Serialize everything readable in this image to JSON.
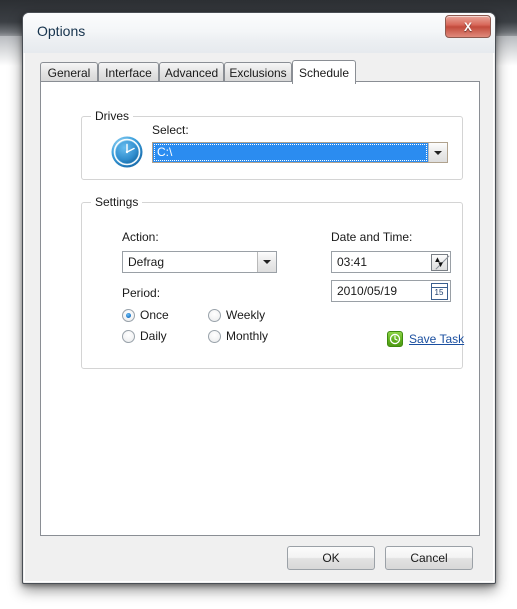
{
  "window": {
    "title": "Options",
    "close_label": "X"
  },
  "tabs": [
    {
      "label": "General",
      "active": false
    },
    {
      "label": "Interface",
      "active": false
    },
    {
      "label": "Advanced",
      "active": false
    },
    {
      "label": "Exclusions",
      "active": false
    },
    {
      "label": "Schedule",
      "active": true
    }
  ],
  "drives": {
    "legend": "Drives",
    "select_label": "Select:",
    "selected_drive": "C:\\",
    "icon": "clock-disk-icon"
  },
  "settings": {
    "legend": "Settings",
    "action_label": "Action:",
    "action_value": "Defrag",
    "period_label": "Period:",
    "period_options": [
      {
        "label": "Once",
        "checked": true
      },
      {
        "label": "Weekly",
        "checked": false
      },
      {
        "label": "Daily",
        "checked": false
      },
      {
        "label": "Monthly",
        "checked": false
      }
    ],
    "datetime_label": "Date and Time:",
    "time_value": "03:41",
    "date_value": "2010/05/19",
    "calendar_day": "15",
    "spin_up": "▲",
    "spin_down": "▼",
    "save_task_label": "Save Task",
    "save_task_icon": "green-clock-icon"
  },
  "footer": {
    "ok_label": "OK",
    "cancel_label": "Cancel"
  },
  "colors": {
    "selection_blue": "#2b8cf0",
    "link_blue": "#1a4fa0",
    "save_icon_green": "#5fb01c",
    "close_red": "#c24b3c"
  }
}
